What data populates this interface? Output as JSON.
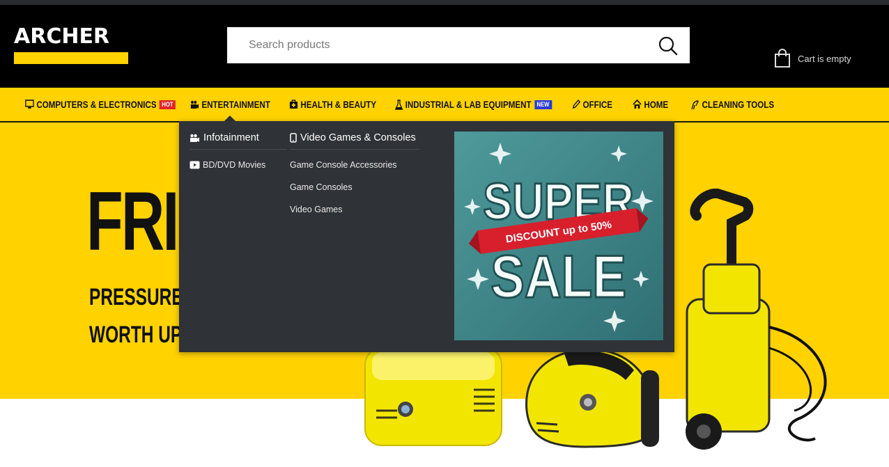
{
  "logo": {
    "text": "ARCHER"
  },
  "search": {
    "placeholder": "Search products"
  },
  "cart": {
    "label": "Cart is empty"
  },
  "nav": {
    "items": [
      {
        "label": "COMPUTERS & ELECTRONICS",
        "badge": "HOT",
        "icon": "monitor-icon"
      },
      {
        "label": "ENTERTAINMENT",
        "icon": "camera-icon"
      },
      {
        "label": "HEALTH & BEAUTY",
        "icon": "first-aid-icon"
      },
      {
        "label": "INDUSTRIAL & LAB EQUIPMENT",
        "badge": "NEW",
        "icon": "flask-icon"
      },
      {
        "label": "OFFICE",
        "icon": "pencil-icon"
      },
      {
        "label": "HOME",
        "icon": "house-icon"
      },
      {
        "label": "CLEANING TOOLS",
        "icon": "hair-dryer-icon"
      }
    ]
  },
  "mega_menu": {
    "columns": [
      {
        "title": "Infotainment",
        "icon": "camera-icon",
        "links": [
          {
            "label": "BD/DVD Movies",
            "icon": "play-icon"
          }
        ]
      },
      {
        "title": "Video Games & Consoles",
        "icon": "phone-icon",
        "links": [
          {
            "label": "Game Console Accessories"
          },
          {
            "label": "Game Consoles"
          },
          {
            "label": "Video Games"
          }
        ]
      }
    ],
    "promo": {
      "line1": "SUPER",
      "ribbon": "DISCOUNT up to 50%",
      "line2": "SALE"
    }
  },
  "hero": {
    "big_text": "FRI",
    "line1": "PRESSURE",
    "line2": "WORTH UP"
  },
  "colors": {
    "accent": "#ffd200",
    "header_bg": "#000000",
    "menu_bg": "#2f3237",
    "hot": "#e0262c",
    "new": "#2a3bd8"
  }
}
